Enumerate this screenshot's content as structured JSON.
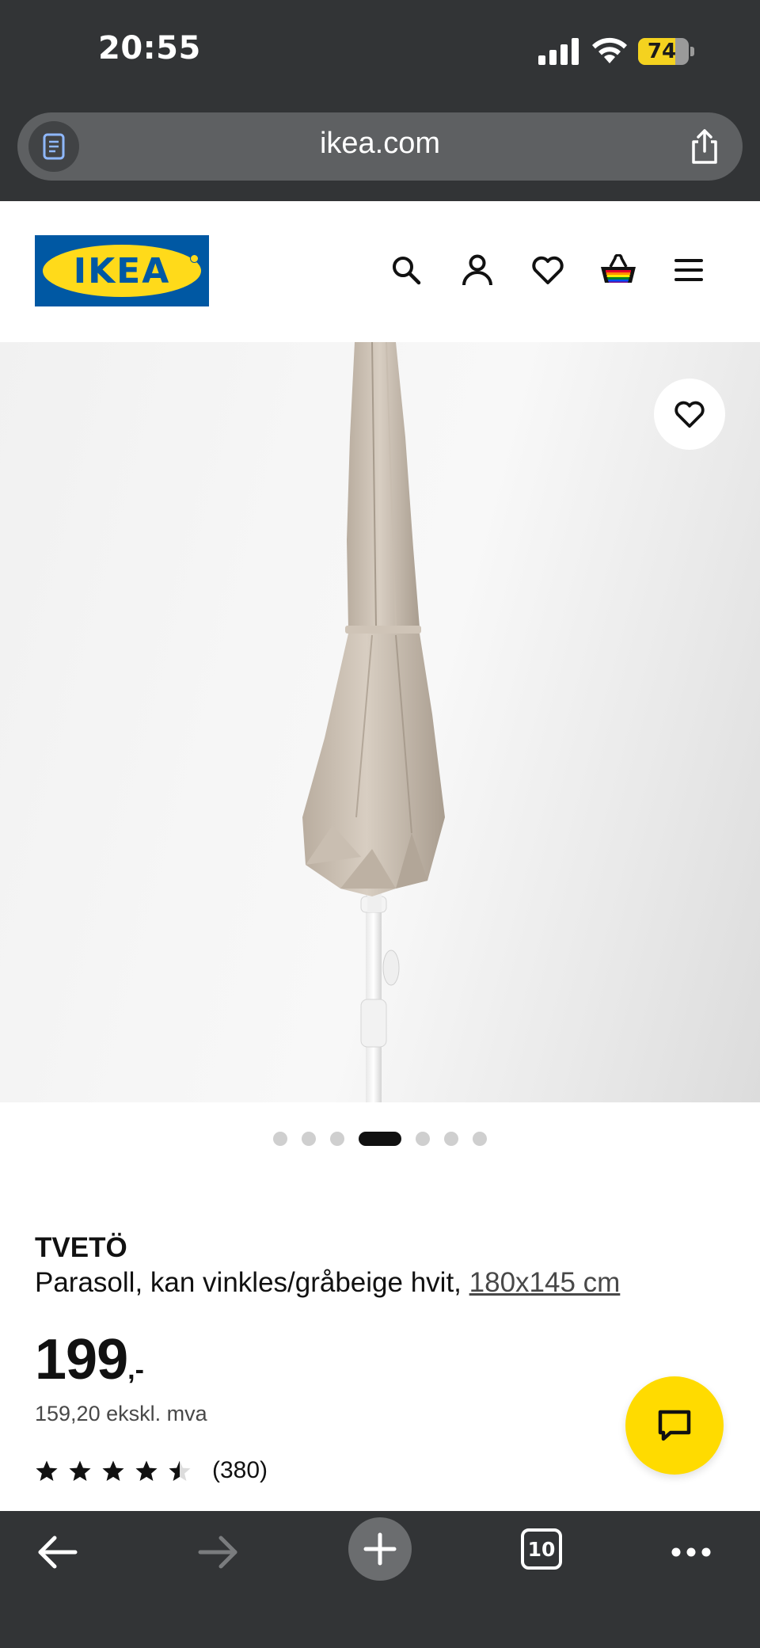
{
  "status_bar": {
    "time": "20:55",
    "battery_level": "74",
    "battery_fraction": 0.74,
    "battery_color": "#f4d21f"
  },
  "browser": {
    "url": "ikea.com",
    "reader_icon": "reader-icon",
    "share_icon": "share-icon"
  },
  "header": {
    "logo_text": "IKEA",
    "icons": [
      "search-icon",
      "account-icon",
      "favourites-icon",
      "cart-icon",
      "menu-icon"
    ]
  },
  "gallery": {
    "image_count": 7,
    "active_index": 3
  },
  "product": {
    "name": "TVETÖ",
    "description": "Parasoll, kan vinkles/gråbeige hvit,",
    "size": "180x145 cm",
    "price": "199",
    "price_suffix": ",-",
    "price_excl_vat": "159,20 ekskl. mva",
    "rating": 4.5,
    "rating_max": 5,
    "review_count": "(380)"
  },
  "colors": {
    "ikea_blue": "#0058a3",
    "ikea_yellow": "#ffdb00",
    "browser_chrome": "#323436"
  },
  "toolbar": {
    "tab_count": "10"
  }
}
